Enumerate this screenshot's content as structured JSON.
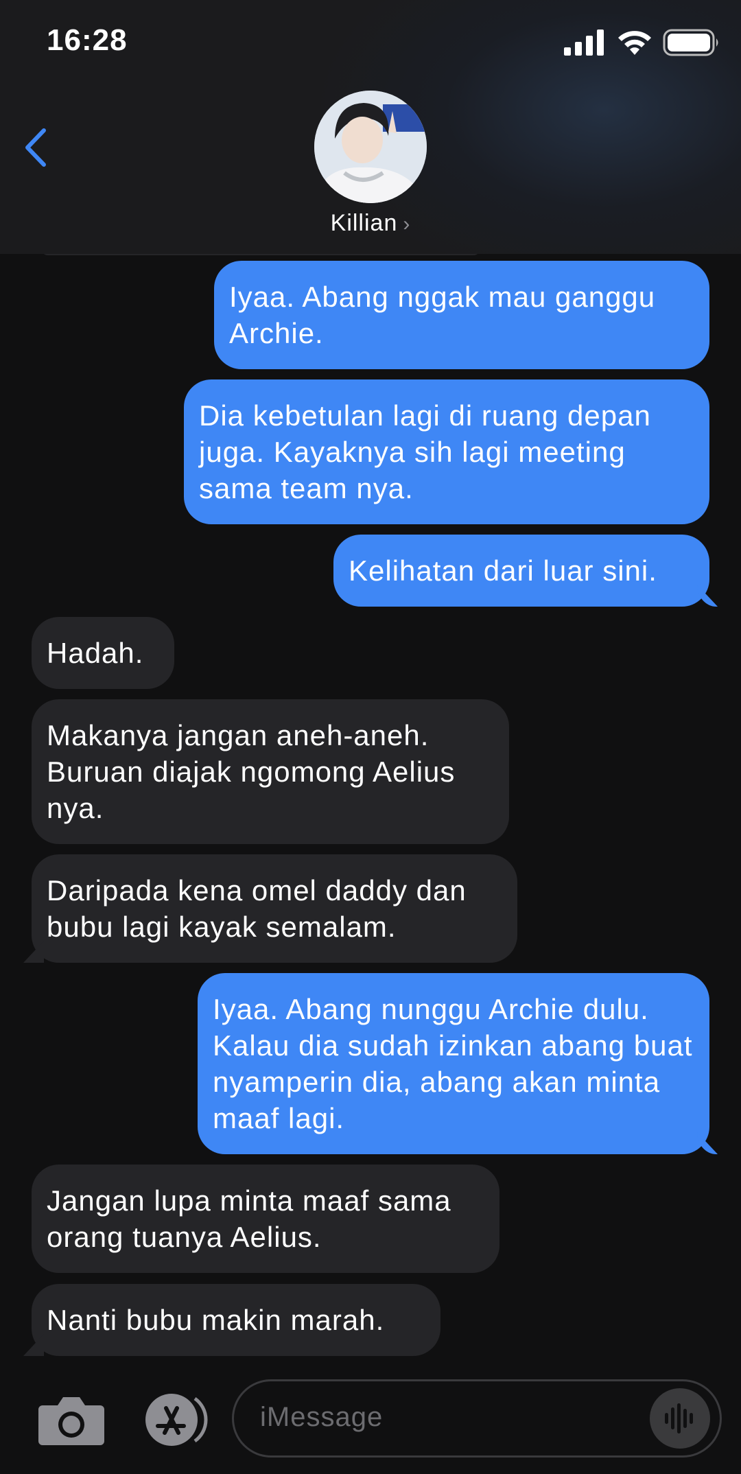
{
  "status_bar": {
    "time": "16:28"
  },
  "header": {
    "contact_name": "Killian",
    "chevron": "›"
  },
  "messages": [
    {
      "side": "out",
      "text": "Iyaa. Abang nggak mau ganggu Archie."
    },
    {
      "side": "out",
      "text": "Dia kebetulan lagi di ruang depan juga. Kayaknya sih lagi meeting sama team nya."
    },
    {
      "side": "out",
      "text": "Kelihatan dari luar sini."
    },
    {
      "side": "in",
      "text": "Hadah."
    },
    {
      "side": "in",
      "text": "Makanya jangan aneh-aneh. Buruan diajak ngomong Aelius nya."
    },
    {
      "side": "in",
      "text": "Daripada kena omel daddy dan bubu lagi kayak semalam."
    },
    {
      "side": "out",
      "text": "Iyaa. Abang nunggu Archie dulu. Kalau dia sudah izinkan abang buat nyamperin dia, abang akan minta maaf lagi."
    },
    {
      "side": "in",
      "text": "Jangan lupa minta maaf sama orang tuanya Aelius."
    },
    {
      "side": "in",
      "text": "Nanti bubu makin marah."
    }
  ],
  "input": {
    "placeholder": "iMessage"
  },
  "colors": {
    "outgoing": "#3f87f5",
    "incoming": "#252528",
    "accent": "#3f87f5"
  },
  "icons": [
    "back-chevron-icon",
    "signal-icon",
    "wifi-icon",
    "battery-icon",
    "camera-icon",
    "app-store-icon",
    "audio-waveform-icon"
  ]
}
